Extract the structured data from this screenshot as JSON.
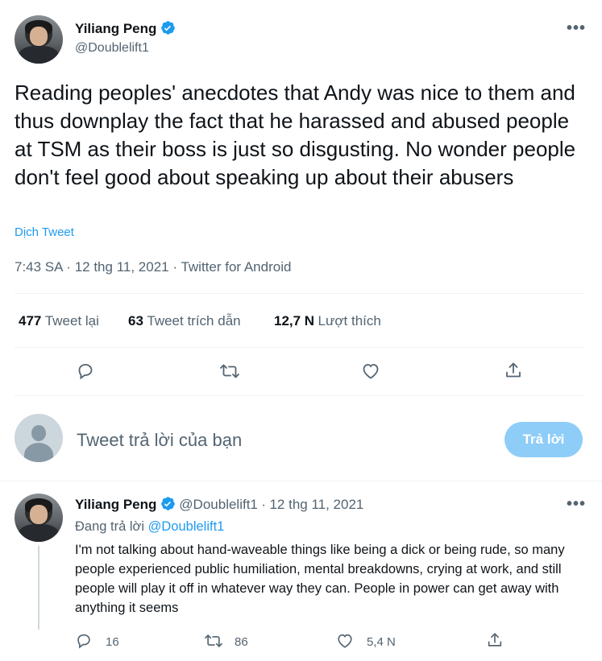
{
  "main_tweet": {
    "author_name": "Yiliang Peng",
    "author_handle": "@Doublelift1",
    "text": "Reading peoples' anecdotes that Andy was nice to them and thus downplay the fact that he harassed and abused people at TSM as their boss is just so disgusting. No wonder people don't feel good about speaking up about their abusers",
    "translate_label": "Dịch Tweet",
    "time": "7:43 SA",
    "date": "12 thg 11, 2021",
    "source": "Twitter for Android",
    "separator": "·",
    "stats": {
      "retweets_count": "477",
      "retweets_label": "Tweet lại",
      "quotes_count": "63",
      "quotes_label": "Tweet trích dẫn",
      "likes_count": "12,7 N",
      "likes_label": "Lượt thích"
    },
    "actions": [
      "reply-icon",
      "retweet-icon",
      "like-icon",
      "share-icon"
    ]
  },
  "composer": {
    "placeholder": "Tweet trả lời của bạn",
    "reply_button": "Trả lời"
  },
  "reply_tweet": {
    "author_name": "Yiliang Peng",
    "author_handle": "@Doublelift1",
    "date": "12 thg 11, 2021",
    "separator": "·",
    "replying_prefix": "Đang trả lời",
    "replying_to": "@Doublelift1",
    "text": "I'm not talking about hand-waveable things like being a dick or being rude, so many people experienced public humiliation, mental breakdowns, crying at work, and still people will play it off in whatever way they can. People in power can get away with anything it seems",
    "reply_count": "16",
    "retweet_count": "86",
    "like_count": "5,4 N"
  },
  "colors": {
    "accent": "#1d9bf0",
    "muted": "#536471",
    "text": "#0f1419",
    "reply_button_bg": "#8ecdf8"
  }
}
